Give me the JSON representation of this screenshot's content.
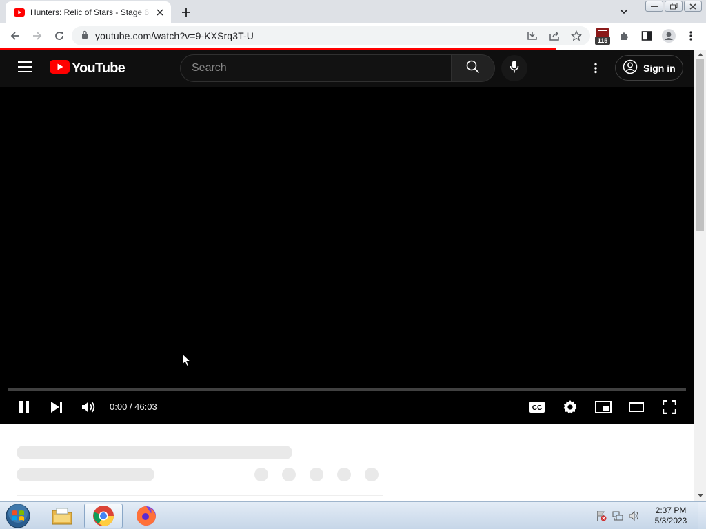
{
  "browser": {
    "tab_title": "Hunters: Relic of Stars - Stage 6 -",
    "url": "youtube.com/watch?v=9-KXSrq3T-U",
    "extension_badge": "115"
  },
  "youtube": {
    "logo_text": "YouTube",
    "search_placeholder": "Search",
    "signin_label": "Sign in"
  },
  "player": {
    "state": "playing",
    "time_display": "0:00 / 46:03",
    "progress": 0.0
  },
  "taskbar": {
    "apps": [
      "start-orb",
      "file-explorer",
      "google-chrome",
      "firefox"
    ],
    "active_app": "google-chrome",
    "clock_time": "2:37 PM",
    "clock_date": "5/3/2023"
  },
  "colors": {
    "youtube_red": "#ff0000",
    "player_bg": "#000000",
    "header_bg": "#0f0f0f"
  }
}
